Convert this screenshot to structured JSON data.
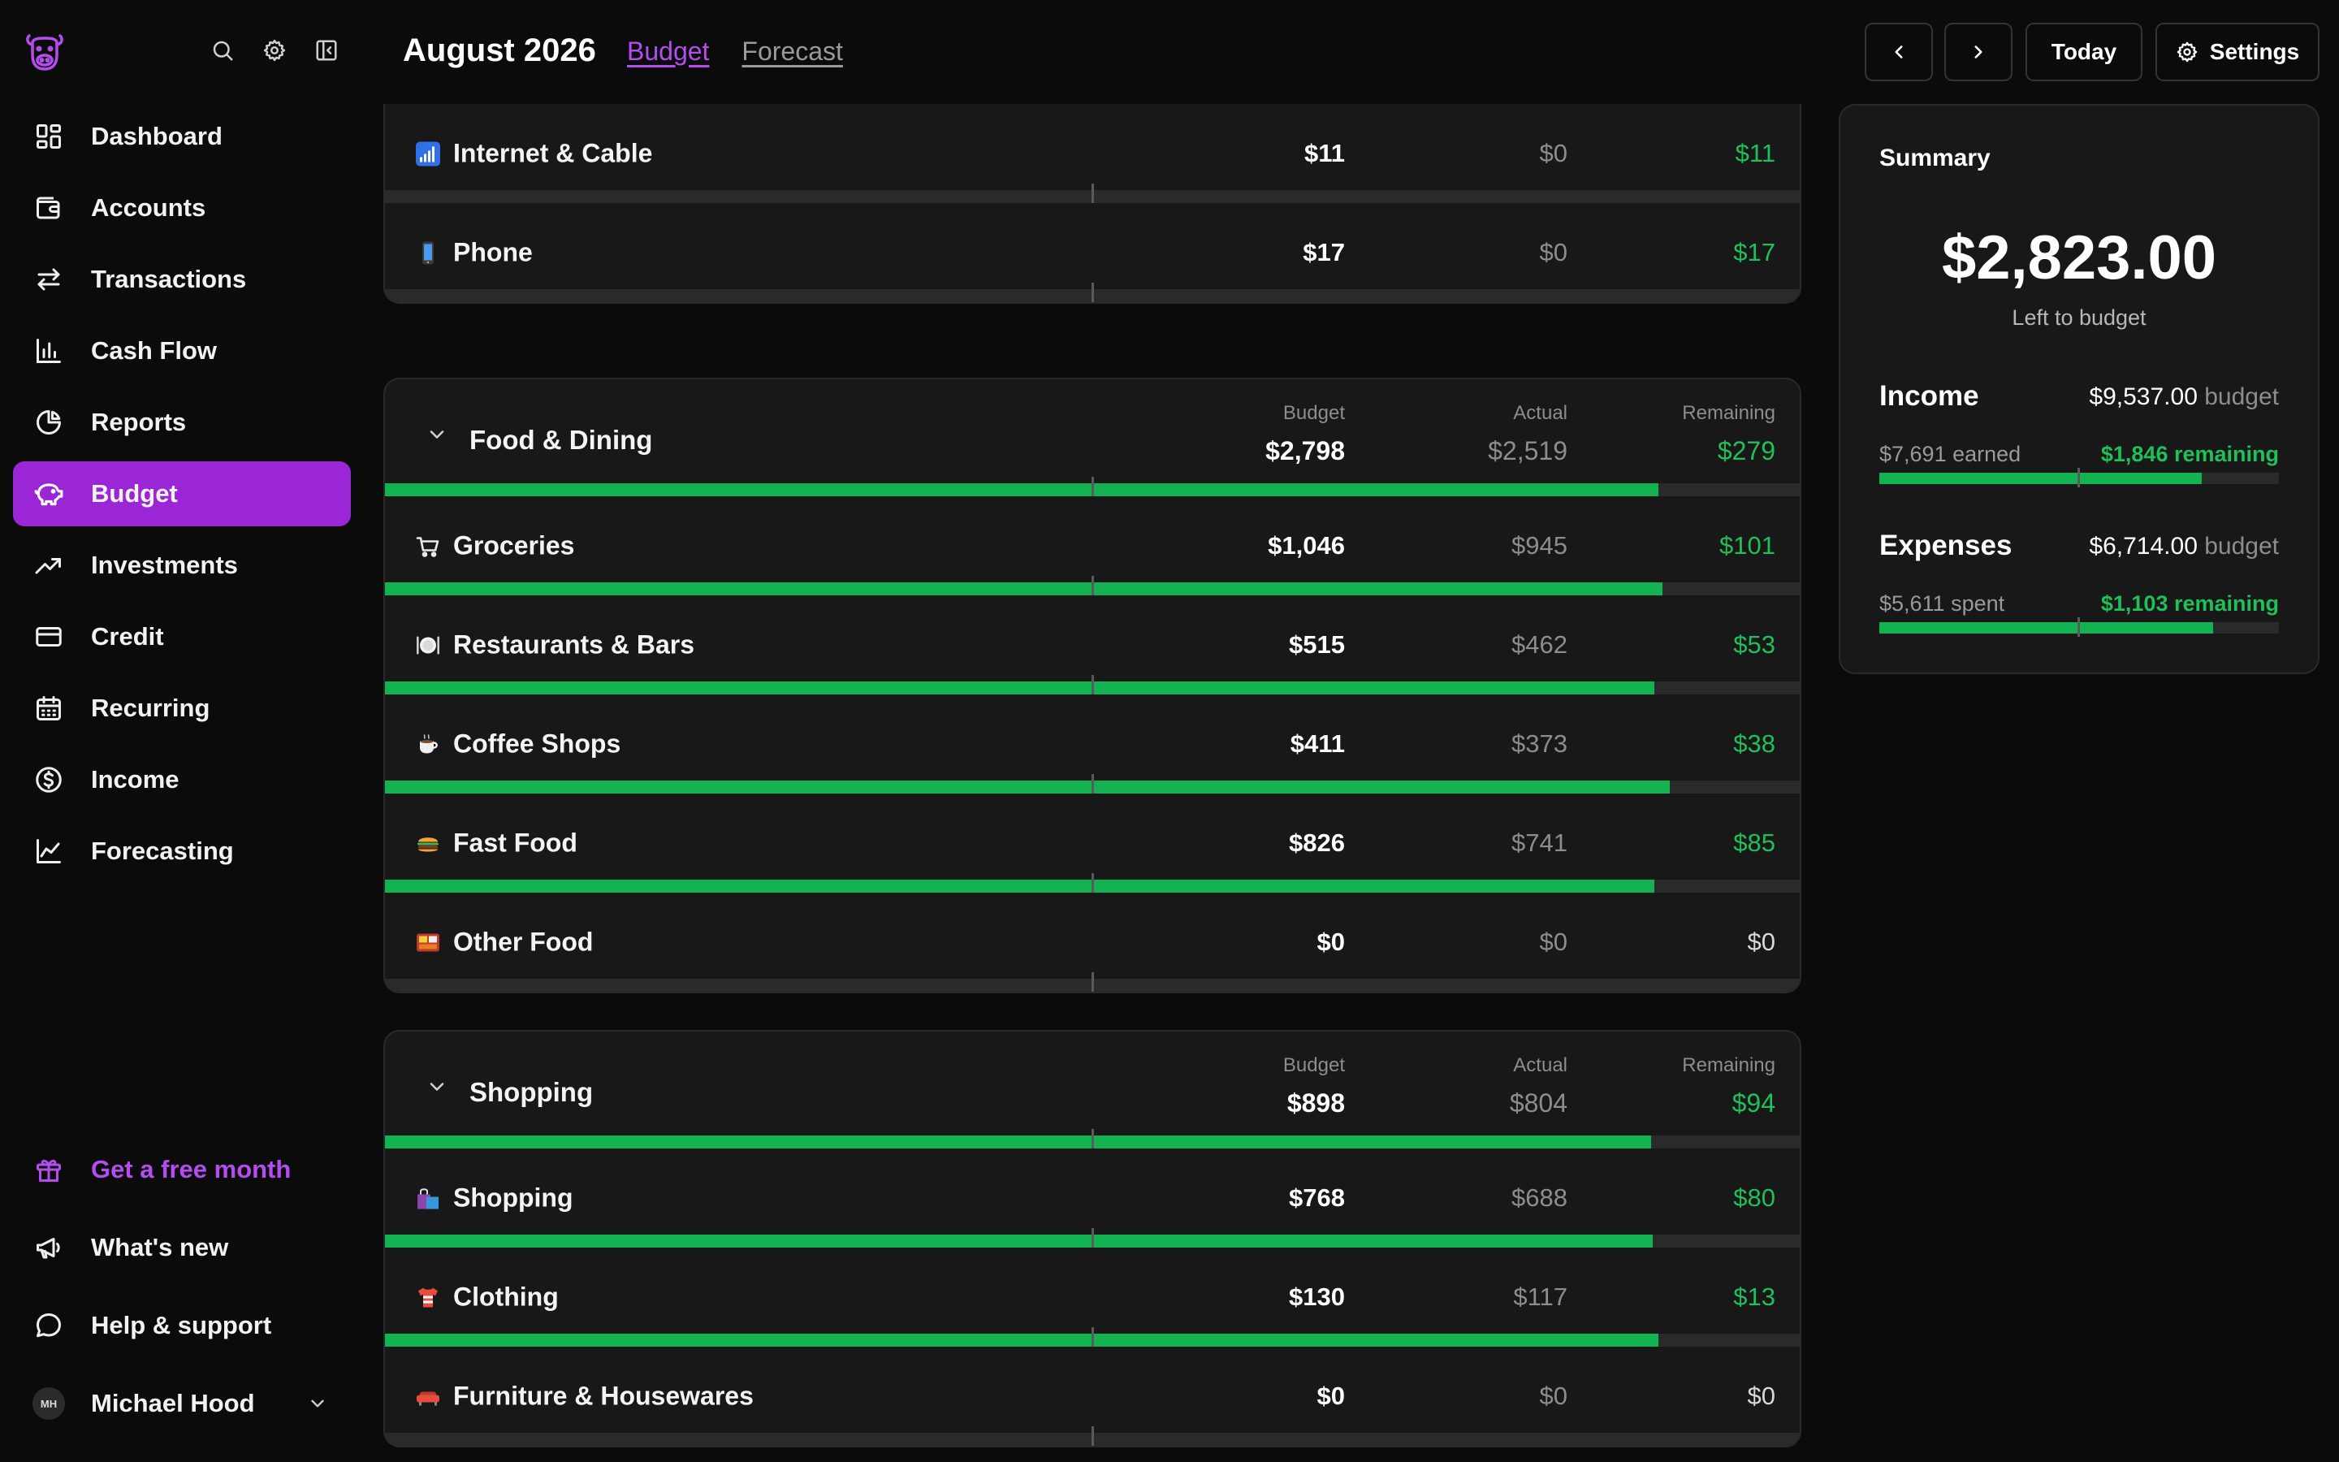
{
  "header": {
    "month": "August 2026",
    "tabs": [
      {
        "label": "Budget",
        "active": true
      },
      {
        "label": "Forecast",
        "active": false
      }
    ],
    "today_label": "Today",
    "settings_label": "Settings"
  },
  "sidebar": {
    "items": [
      {
        "label": "Dashboard",
        "icon": "dashboard-icon",
        "active": false
      },
      {
        "label": "Accounts",
        "icon": "wallet-icon",
        "active": false
      },
      {
        "label": "Transactions",
        "icon": "arrows-swap-icon",
        "active": false
      },
      {
        "label": "Cash Flow",
        "icon": "bar-chart-icon",
        "active": false
      },
      {
        "label": "Reports",
        "icon": "pie-chart-icon",
        "active": false
      },
      {
        "label": "Budget",
        "icon": "piggy-bank-icon",
        "active": true
      },
      {
        "label": "Investments",
        "icon": "trend-up-icon",
        "active": false
      },
      {
        "label": "Credit",
        "icon": "credit-card-icon",
        "active": false
      },
      {
        "label": "Recurring",
        "icon": "calendar-icon",
        "active": false
      },
      {
        "label": "Income",
        "icon": "dollar-circle-icon",
        "active": false
      },
      {
        "label": "Forecasting",
        "icon": "line-chart-icon",
        "active": false
      }
    ],
    "bottom": {
      "promo": "Get a free month",
      "whats_new": "What's new",
      "help": "Help & support",
      "user_initials": "MH",
      "user_name": "Michael Hood"
    }
  },
  "groups": [
    {
      "partial": true,
      "rows": [
        {
          "partial": true,
          "fill": 0.815
        },
        {
          "emoji": "antenna",
          "name": "Internet & Cable",
          "budget": "$11",
          "actual": "$0",
          "remaining": "$11",
          "fill": 0.0
        },
        {
          "emoji": "mobile-phone",
          "name": "Phone",
          "budget": "$17",
          "actual": "$0",
          "remaining": "$17",
          "fill": 0.0
        }
      ]
    },
    {
      "name": "Food & Dining",
      "col_budget": "Budget",
      "col_actual": "Actual",
      "col_remaining": "Remaining",
      "budget": "$2,798",
      "actual": "$2,519",
      "remaining": "$279",
      "fill": 0.9,
      "rows": [
        {
          "emoji": "shopping-cart",
          "name": "Groceries",
          "budget": "$1,046",
          "actual": "$945",
          "remaining": "$101",
          "fill": 0.903
        },
        {
          "emoji": "plate",
          "name": "Restaurants & Bars",
          "budget": "$515",
          "actual": "$462",
          "remaining": "$53",
          "fill": 0.897
        },
        {
          "emoji": "coffee",
          "name": "Coffee Shops",
          "budget": "$411",
          "actual": "$373",
          "remaining": "$38",
          "fill": 0.908
        },
        {
          "emoji": "burger",
          "name": "Fast Food",
          "budget": "$826",
          "actual": "$741",
          "remaining": "$85",
          "fill": 0.897
        },
        {
          "emoji": "bento",
          "name": "Other Food",
          "budget": "$0",
          "actual": "$0",
          "remaining": "$0",
          "fill": 0.0,
          "zero": true
        }
      ]
    },
    {
      "name": "Shopping",
      "col_budget": "Budget",
      "col_actual": "Actual",
      "col_remaining": "Remaining",
      "budget": "$898",
      "actual": "$804",
      "remaining": "$94",
      "fill": 0.895,
      "rows": [
        {
          "emoji": "shopping-bags",
          "name": "Shopping",
          "budget": "$768",
          "actual": "$688",
          "remaining": "$80",
          "fill": 0.896
        },
        {
          "emoji": "shirt",
          "name": "Clothing",
          "budget": "$130",
          "actual": "$117",
          "remaining": "$13",
          "fill": 0.9
        },
        {
          "emoji": "couch",
          "name": "Furniture & Housewares",
          "budget": "$0",
          "actual": "$0",
          "remaining": "$0",
          "fill": 0.0,
          "zero": true
        }
      ]
    }
  ],
  "summary": {
    "title": "Summary",
    "left_amount": "$2,823.00",
    "left_label": "Left to budget",
    "income": {
      "label": "Income",
      "amount": "$9,537.00",
      "suffix": "budget",
      "progress_text": "$7,691 earned",
      "remaining_text": "$1,846 remaining",
      "fill": 0.806
    },
    "expenses": {
      "label": "Expenses",
      "amount": "$6,714.00",
      "suffix": "budget",
      "progress_text": "$5,611 spent",
      "remaining_text": "$1,103 remaining",
      "fill": 0.836
    }
  },
  "colors": {
    "accent": "#9b26d6",
    "accent_text": "#b44df0",
    "green": "#14b352",
    "card_bg": "#181818",
    "page_bg": "#0b0b0b"
  }
}
